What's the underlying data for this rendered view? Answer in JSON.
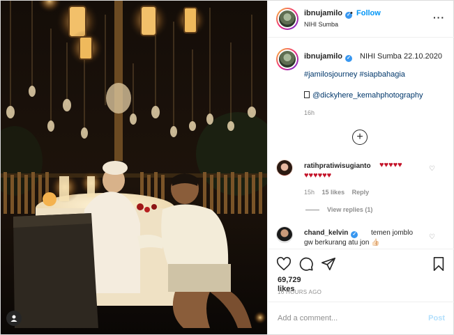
{
  "header": {
    "username": "ibnujamilo",
    "separator": "•",
    "follow_label": "Follow",
    "location": "NIHI Sumba",
    "more_icon": "more-options-icon"
  },
  "caption": {
    "username": "ibnujamilo",
    "text": "NIHI Sumba 22.10.2020",
    "hashtags": "#jamilosjourney #siapbahagia",
    "photographer": "@dickyhere_kemahphotography",
    "time": "16h"
  },
  "comments": [
    {
      "username": "ratihpratiwisugianto",
      "hearts_line1": "♥♥♥♥♥",
      "hearts_line2": "♥♥♥♥♥♥",
      "time": "15h",
      "likes": "15 likes",
      "reply_label": "Reply",
      "view_replies": "View replies (1)"
    },
    {
      "username": "chand_kelvin",
      "text_line1": "temen jomblo",
      "text_line2": "gw berkurang atu jon 👍🏻"
    }
  ],
  "actions": {
    "likes_count": "69,729",
    "likes_label": "likes",
    "timestamp": "16 HOURS AGO"
  },
  "add_comment": {
    "placeholder": "Add a comment...",
    "post_label": "Post"
  },
  "colors": {
    "accent": "#0095f6",
    "verified": "#3897f0",
    "heart": "#c4142a"
  }
}
